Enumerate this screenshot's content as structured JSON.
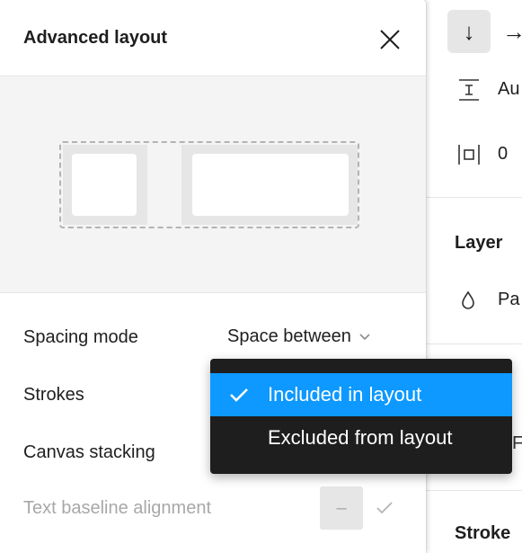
{
  "modal": {
    "title": "Advanced layout",
    "rows": {
      "spacing_mode_label": "Spacing mode",
      "spacing_mode_value": "Space between",
      "strokes_label": "Strokes",
      "canvas_stacking_label": "Canvas stacking",
      "text_baseline_label": "Text baseline alignment",
      "text_baseline_value": "–"
    }
  },
  "dropdown": {
    "items": [
      {
        "label": "Included in layout",
        "selected": true
      },
      {
        "label": "Excluded from layout",
        "selected": false
      }
    ]
  },
  "right_panel": {
    "direction_down": "↓",
    "direction_right": "→",
    "spacing_value": "Au",
    "padding_value": "0",
    "layer_title": "Layer",
    "pass_through_value": "Pa",
    "partial_value": "F",
    "stroke_title": "Stroke"
  },
  "colors": {
    "accent": "#0d99ff",
    "menu_bg": "#1e1e1e",
    "preview_bg": "#f4f4f4"
  }
}
